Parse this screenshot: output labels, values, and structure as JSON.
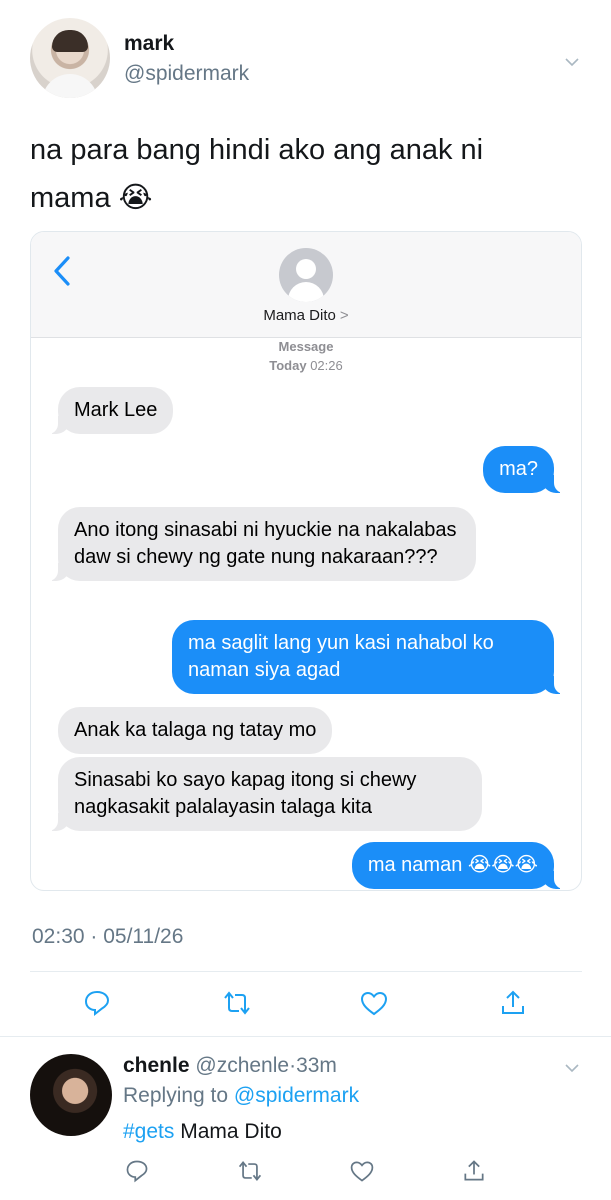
{
  "tweet": {
    "name": "mark",
    "handle": "@spidermark",
    "text": "na para bang hindi ako ang anak ni mama 😭",
    "timestamp": "02:30 · 05/11/26"
  },
  "imessage": {
    "contact": "Mama Dito",
    "contact_chevron": ">",
    "service": "Message",
    "day": "Today",
    "time": "02:26",
    "messages": [
      {
        "from": "in",
        "text": "Mark Lee"
      },
      {
        "from": "out",
        "text": "ma?"
      },
      {
        "from": "in",
        "text": "Ano itong sinasabi ni hyuckie na nakalabas daw si chewy ng gate nung nakaraan???"
      },
      {
        "from": "out",
        "text": "ma saglit lang yun kasi nahabol ko naman siya agad"
      },
      {
        "from": "in",
        "text": "Anak ka talaga ng tatay mo"
      },
      {
        "from": "in",
        "text": "Sinasabi ko sayo kapag itong si chewy nagkasakit palalayasin talaga kita"
      },
      {
        "from": "out",
        "text": "ma naman 😭😭😭"
      }
    ]
  },
  "actions": [
    "reply-icon",
    "retweet-icon",
    "like-icon",
    "share-icon"
  ],
  "reply": {
    "name": "chenle",
    "handle": "@zchenle",
    "separator": "·",
    "age": "33m",
    "replying_prefix": "Replying to",
    "replying_handle": "@spidermark",
    "hashtag": "#gets",
    "text": "Mama Dito"
  },
  "colors": {
    "link": "#1da1f2",
    "imessage_blue": "#1b8ef8",
    "incoming_bubble": "#e9e9eb",
    "secondary_text": "#657786"
  }
}
